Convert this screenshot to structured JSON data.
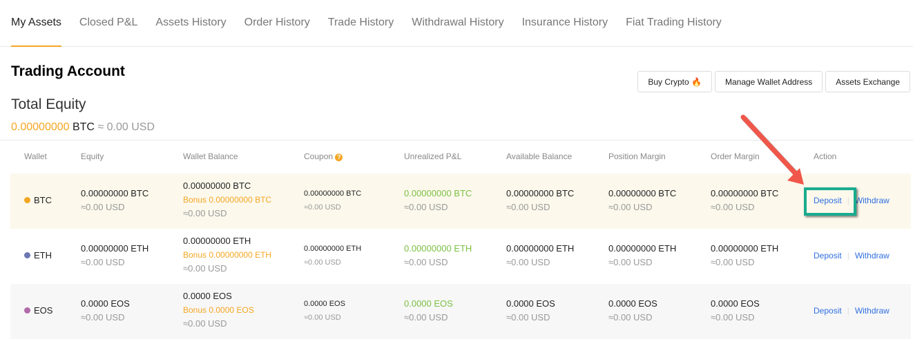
{
  "tabs": [
    "My Assets",
    "Closed P&L",
    "Assets History",
    "Order History",
    "Trade History",
    "Withdrawal History",
    "Insurance History",
    "Fiat Trading History"
  ],
  "title": "Trading Account",
  "buttons": {
    "buy": "Buy Crypto",
    "manage": "Manage Wallet Address",
    "exchange": "Assets Exchange"
  },
  "total": {
    "label": "Total Equity",
    "value": "0.00000000",
    "unit": "BTC",
    "usd": "≈ 0.00 USD"
  },
  "headers": [
    "Wallet",
    "Equity",
    "Wallet Balance",
    "Coupon",
    "Unrealized P&L",
    "Available Balance",
    "Position Margin",
    "Order Margin",
    "Action"
  ],
  "rows": [
    {
      "coin": "BTC",
      "color": "#f5a623",
      "equity": "0.00000000 BTC",
      "wallet": "0.00000000 BTC",
      "bonus": "Bonus 0.00000000 BTC",
      "coupon": "0.00000000 BTC",
      "upnl": "0.00000000 BTC",
      "avail": "0.00000000 BTC",
      "pos": "0.00000000 BTC",
      "order": "0.00000000 BTC",
      "usd": "≈0.00 USD"
    },
    {
      "coin": "ETH",
      "color": "#6b77b3",
      "equity": "0.00000000 ETH",
      "wallet": "0.00000000 ETH",
      "bonus": "Bonus 0.00000000 ETH",
      "coupon": "0.00000000 ETH",
      "upnl": "0.00000000 ETH",
      "avail": "0.00000000 ETH",
      "pos": "0.00000000 ETH",
      "order": "0.00000000 ETH",
      "usd": "≈0.00 USD"
    },
    {
      "coin": "EOS",
      "color": "#b06aa8",
      "equity": "0.0000 EOS",
      "wallet": "0.0000 EOS",
      "bonus": "Bonus 0.0000 EOS",
      "coupon": "0.0000 EOS",
      "upnl": "0.0000 EOS",
      "avail": "0.0000 EOS",
      "pos": "0.0000 EOS",
      "order": "0.0000 EOS",
      "usd": "≈0.00 USD"
    }
  ],
  "actions": {
    "deposit": "Deposit",
    "withdraw": "Withdraw"
  }
}
